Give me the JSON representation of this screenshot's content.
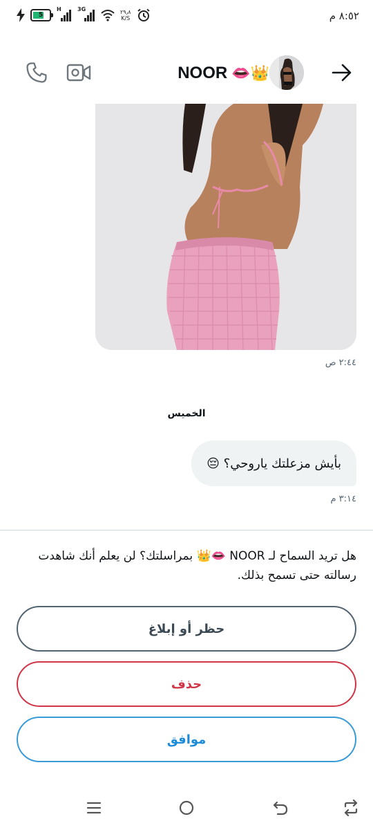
{
  "status_bar": {
    "time": "٨:٥٢ م",
    "battery_level": "5",
    "signal_1_label": "H",
    "signal_2_label": "3G",
    "net_speed_value": "٢٩٫٨",
    "net_speed_unit": "K/S",
    "icons": [
      "charging-bolt-icon",
      "battery-icon",
      "signal-icon",
      "signal-icon",
      "wifi-icon",
      "alarm-icon"
    ]
  },
  "header": {
    "name": "NOOR",
    "name_emoji": "👄👑",
    "icons": [
      "phone-icon",
      "video-call-icon",
      "back-arrow-icon"
    ]
  },
  "messages": {
    "image_time": "٢:٤٤ ص",
    "day_label": "الخميس",
    "text_message": "بأيش مزعلتك ياروحي؟ 😔",
    "text_time": "٣:١٤ م"
  },
  "request": {
    "prompt": "هل تريد السماح لـ NOOR 👄👑 بمراسلتك؟ لن يعلم أنك شاهدت رسالته حتى تسمح بذلك.",
    "block_button": "حظر أو إبلاغ",
    "delete_button": "حذف",
    "accept_button": "موافق"
  },
  "colors": {
    "text_primary": "#0f1419",
    "text_secondary": "#536471",
    "bubble_bg": "#eff3f4",
    "delete_red": "#d03647",
    "accept_blue": "#1d8cd8"
  },
  "nav_bar": {
    "icons": [
      "menu-icon",
      "home-icon",
      "back-icon",
      "rotate-icon"
    ]
  }
}
